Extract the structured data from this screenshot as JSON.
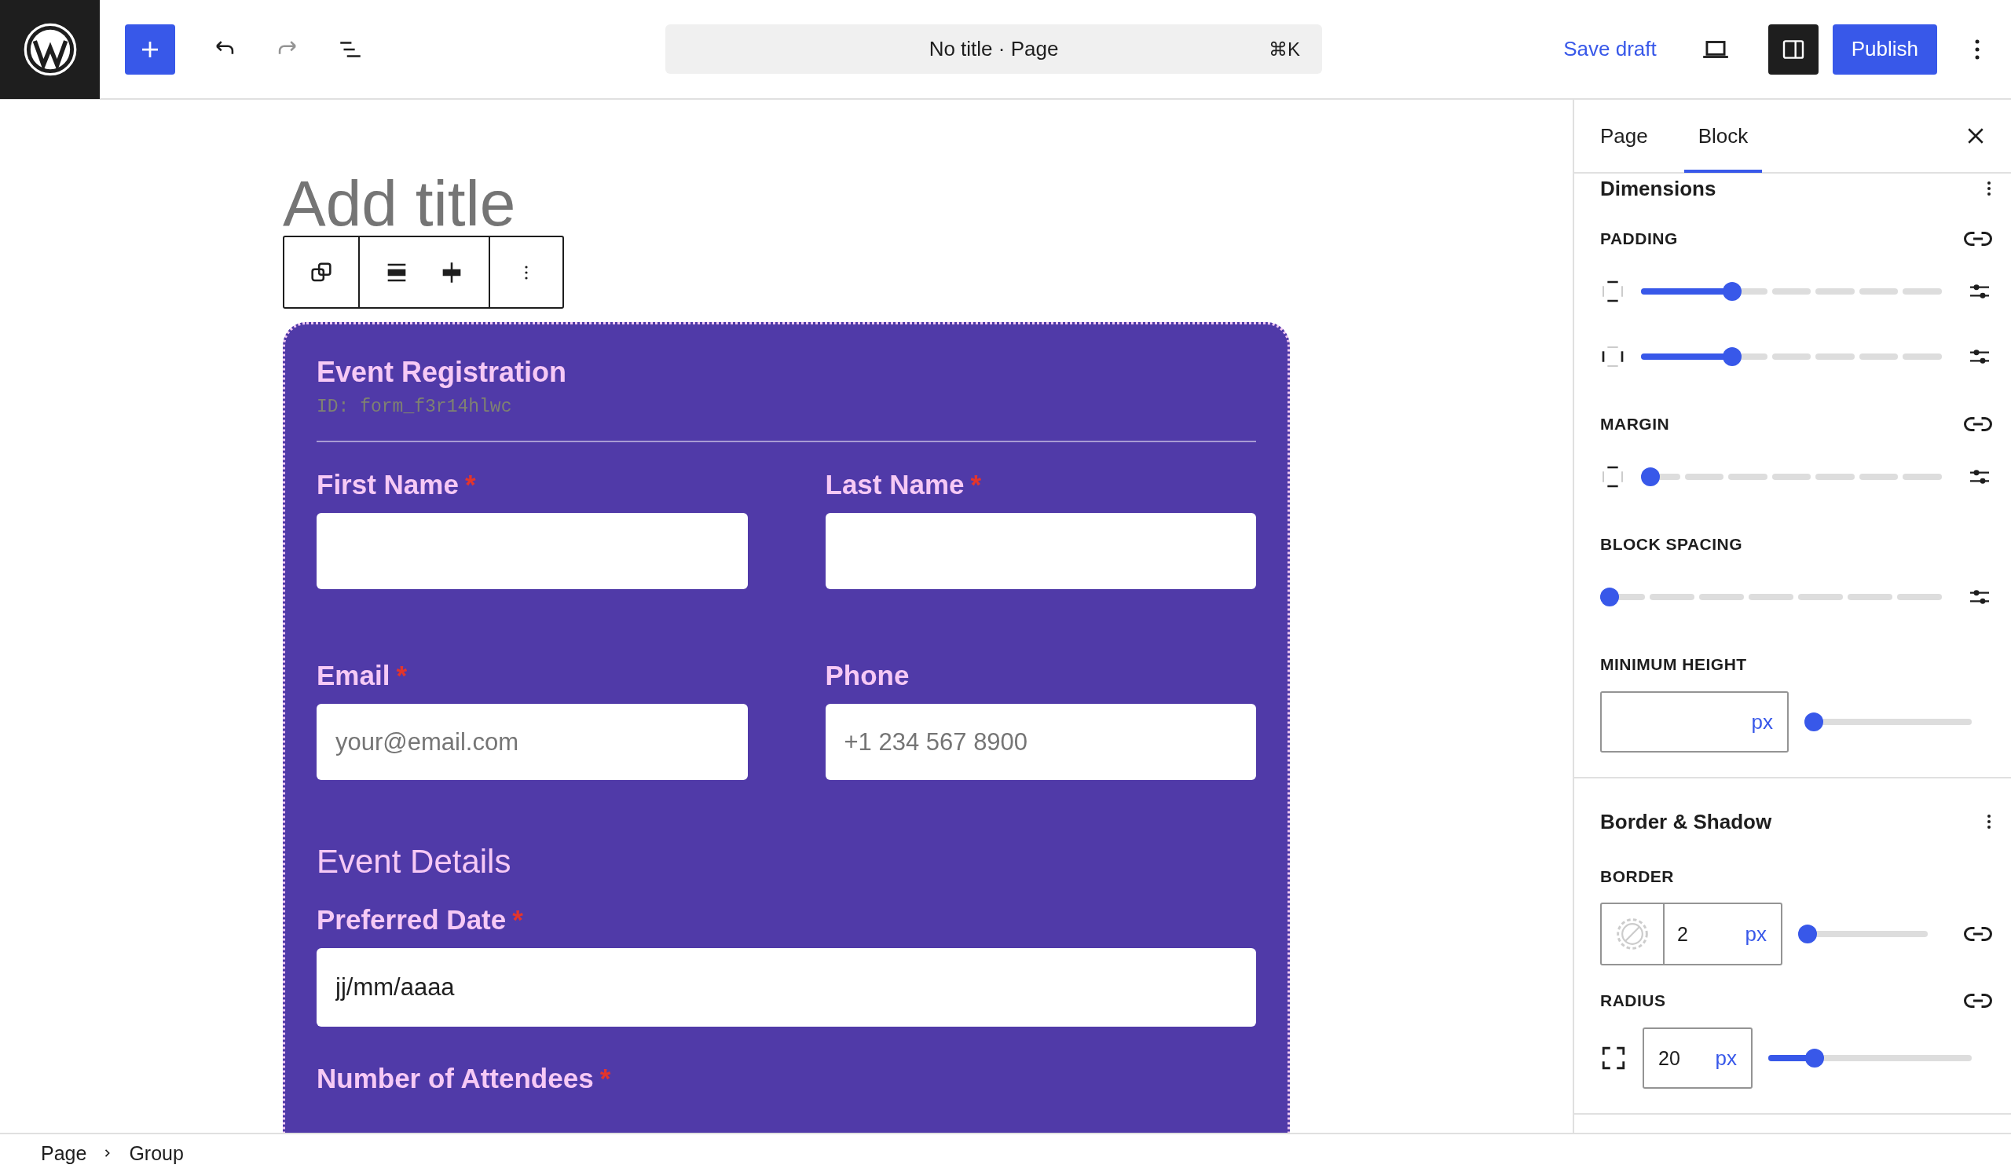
{
  "topbar": {
    "document_title": "No title · Page",
    "shortcut": "⌘K",
    "save_label": "Save draft",
    "publish_label": "Publish"
  },
  "editor": {
    "title_placeholder": "Add title",
    "form": {
      "title": "Event Registration",
      "id_text": "ID: form_f3r14hlwc",
      "items": [
        {
          "kind": "row",
          "fields": [
            {
              "label": "First Name",
              "required_mark": "*"
            },
            {
              "label": "Last Name",
              "required_mark": "*"
            }
          ]
        },
        {
          "kind": "row",
          "fields": [
            {
              "label": "Email",
              "required_mark": "*",
              "placeholder": "your@email.com"
            },
            {
              "label": "Phone",
              "placeholder": "+1 234 567 8900"
            }
          ]
        },
        {
          "kind": "heading",
          "text": "Event Details"
        },
        {
          "kind": "field",
          "label": "Preferred Date",
          "required_mark": "*",
          "value": "jj/mm/aaaa"
        },
        {
          "kind": "label",
          "label": "Number of Attendees",
          "required_mark": "*"
        }
      ]
    }
  },
  "sidebar": {
    "tabs": [
      {
        "label": "Page",
        "selected": false
      },
      {
        "label": "Block",
        "selected": true
      }
    ],
    "panels": [
      {
        "title": "Dimensions",
        "controls": [
          {
            "kind": "label",
            "text": "PADDING",
            "link": true
          },
          {
            "kind": "steps-y",
            "level": 0.29
          },
          {
            "kind": "steps-x",
            "level": 0.29
          },
          {
            "kind": "label",
            "text": "MARGIN",
            "link": true
          },
          {
            "kind": "steps-y",
            "level": 0
          },
          {
            "kind": "label",
            "text": "BLOCK SPACING",
            "link": false
          },
          {
            "kind": "steps",
            "level": 0
          },
          {
            "kind": "label",
            "text": "MINIMUM HEIGHT",
            "link": false
          },
          {
            "kind": "unit-slider",
            "unit": "px",
            "level": 0
          }
        ]
      },
      {
        "title": "Border & Shadow",
        "controls": [
          {
            "kind": "label",
            "text": "BORDER",
            "link": false
          },
          {
            "kind": "border",
            "value": "2",
            "unit": "px",
            "level": 0
          },
          {
            "kind": "label",
            "text": "RADIUS",
            "link": true
          },
          {
            "kind": "radius",
            "value": "20",
            "unit": "px",
            "level": 0.2
          }
        ]
      }
    ]
  },
  "breadcrumb": [
    "Page",
    "Group"
  ]
}
